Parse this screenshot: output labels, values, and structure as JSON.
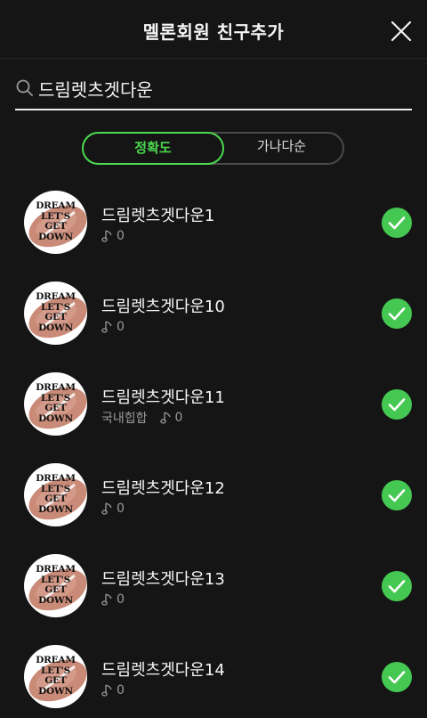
{
  "header": {
    "title": "멜론회원 친구추가",
    "close_icon": "close-icon"
  },
  "search": {
    "query": "드림렛츠겟다운",
    "icon": "search-icon"
  },
  "sort": {
    "options": [
      "정확도",
      "가나다순"
    ],
    "selected": "정확도",
    "active_color": "#4cd94f"
  },
  "avatar_text": [
    "DREAM",
    "LET'S",
    "GET",
    "DOWN"
  ],
  "users": [
    {
      "name": "드림렛츠겟다운1",
      "genre": "",
      "likes": "0"
    },
    {
      "name": "드림렛츠겟다운10",
      "genre": "",
      "likes": "0"
    },
    {
      "name": "드림렛츠겟다운11",
      "genre": "국내힙합",
      "likes": "0"
    },
    {
      "name": "드림렛츠겟다운12",
      "genre": "",
      "likes": "0"
    },
    {
      "name": "드림렛츠겟다운13",
      "genre": "",
      "likes": "0"
    },
    {
      "name": "드림렛츠겟다운14",
      "genre": "",
      "likes": "0"
    }
  ],
  "check_color": "#45c852"
}
